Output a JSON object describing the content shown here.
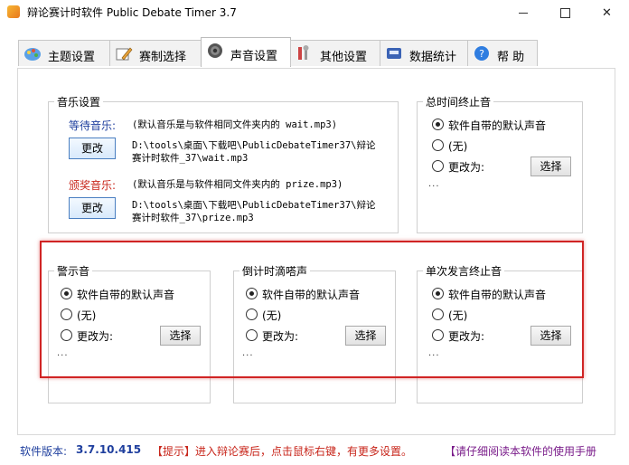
{
  "window": {
    "title": "辩论赛计时软件 Public Debate Timer 3.7",
    "minimize_glyph": "—",
    "close_glyph": "✕"
  },
  "tabs": [
    {
      "label": "主题设置",
      "icon": "palette-icon"
    },
    {
      "label": "赛制选择",
      "icon": "pencil-icon"
    },
    {
      "label": "声音设置",
      "icon": "speaker-icon"
    },
    {
      "label": "其他设置",
      "icon": "tools-icon"
    },
    {
      "label": "数据统计",
      "icon": "chart-disk-icon"
    },
    {
      "label": "帮  助",
      "icon": "help-icon"
    }
  ],
  "music": {
    "title": "音乐设置",
    "wait": {
      "label": "等待音乐:",
      "hint": "(默认音乐是与软件相同文件夹内的 wait.mp3)",
      "button": "更改",
      "path1": "D:\\tools\\桌面\\下载吧\\PublicDebateTimer37\\辩论",
      "path2": "赛计时软件_37\\wait.mp3"
    },
    "prize": {
      "label": "颁奖音乐:",
      "hint": "(默认音乐是与软件相同文件夹内的 prize.mp3)",
      "button": "更改",
      "path1": "D:\\tools\\桌面\\下载吧\\PublicDebateTimer37\\辩论",
      "path2": "赛计时软件_37\\prize.mp3"
    }
  },
  "groups": {
    "total_end": {
      "title": "总时间终止音",
      "opt_default": "软件自带的默认声音",
      "opt_none": "(无)",
      "opt_change": "更改为:",
      "button": "选择",
      "dots": "..."
    },
    "warning": {
      "title": "警示音",
      "opt_default": "软件自带的默认声音",
      "opt_none": "(无)",
      "opt_change": "更改为:",
      "button": "选择",
      "dots": "..."
    },
    "countdown": {
      "title": "倒计时滴嗒声",
      "opt_default": "软件自带的默认声音",
      "opt_none": "(无)",
      "opt_change": "更改为:",
      "button": "选择",
      "dots": "..."
    },
    "single_end": {
      "title": "单次发言终止音",
      "opt_default": "软件自带的默认声音",
      "opt_none": "(无)",
      "opt_change": "更改为:",
      "button": "选择",
      "dots": "..."
    }
  },
  "status": {
    "version_label": "软件版本:",
    "version": "3.7.10.415",
    "tip": "【提示】进入辩论赛后，点击鼠标右键，有更多设置。",
    "manual": "【请仔细阅读本软件的使用手册"
  },
  "colors": {
    "accent_red": "#c8261b",
    "link_blue": "#1f3f9e",
    "highlight_box": "#d02424",
    "button_border": "#4a7fc1"
  }
}
